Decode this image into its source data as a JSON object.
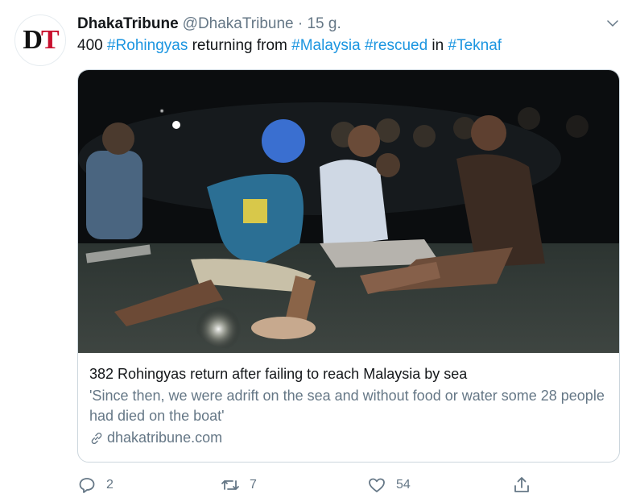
{
  "tweet": {
    "avatar_text_d": "D",
    "avatar_text_t": "T",
    "display_name": "DhakaTribune",
    "handle": "@DhakaTribune · 15 g.",
    "text_parts": [
      {
        "text": "400 ",
        "tag": false
      },
      {
        "text": "#Rohingyas",
        "tag": true
      },
      {
        "text": " returning from ",
        "tag": false
      },
      {
        "text": "#Malaysia",
        "tag": true
      },
      {
        "text": " ",
        "tag": false
      },
      {
        "text": "#rescued",
        "tag": true
      },
      {
        "text": " in ",
        "tag": false
      },
      {
        "text": "#Teknaf",
        "tag": true
      }
    ]
  },
  "card": {
    "title": "382 Rohingyas return after failing to reach Malaysia by sea",
    "description": "'Since then, we were adrift on the sea and without food or water some 28 people had died on the boat'",
    "domain": "dhakatribune.com",
    "image_alt": "Photo of Rohingya people sitting on a beach at night"
  },
  "actions": {
    "reply_count": "2",
    "retweet_count": "7",
    "like_count": "54"
  },
  "colors": {
    "link": "#1b95e0",
    "secondary_text": "#657786",
    "border": "#ccd6dd"
  }
}
